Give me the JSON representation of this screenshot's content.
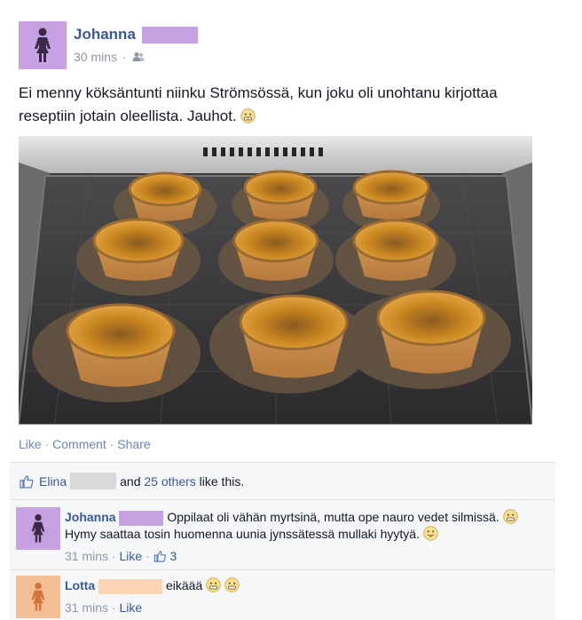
{
  "post": {
    "author": "Johanna",
    "time": "30 mins",
    "separator": "·",
    "audience_icon": "friends-icon",
    "text": "Ei menny köksäntunti niinku Strömsössä, kun joku oli unohtanu kirjottaa reseptiin jotain oleellista. Jauhot.",
    "photo_icon": "baking-tray-muffins-photo",
    "actions": [
      "Like",
      "Comment",
      "Share"
    ]
  },
  "likes": {
    "first_name": "Elina",
    "and_text": "and",
    "others": "25 others",
    "suffix": "like this."
  },
  "comments": [
    {
      "name": "Johanna",
      "text": "Oppilaat oli vähän myrtsinä, mutta ope nauro vedet silmissä.",
      "text2": "Hymy saattaa tosin huomenna uunia jynssätessä mullaki hyytyä.",
      "time": "31 mins",
      "like_label": "Like",
      "like_count": "3"
    },
    {
      "name": "Lotta",
      "text": "eikäää",
      "time": "31 mins",
      "like_label": "Like"
    }
  ],
  "colors": {
    "link": "#3b5998",
    "meta": "#9197a3",
    "female_avatar_purple": "#c6a2e2",
    "female_avatar_peach": "#f5bf95",
    "redaction_purple": "#c6a2e2",
    "redaction_peach": "#fcd5b5",
    "redaction_grey": "#d9d9d9"
  }
}
